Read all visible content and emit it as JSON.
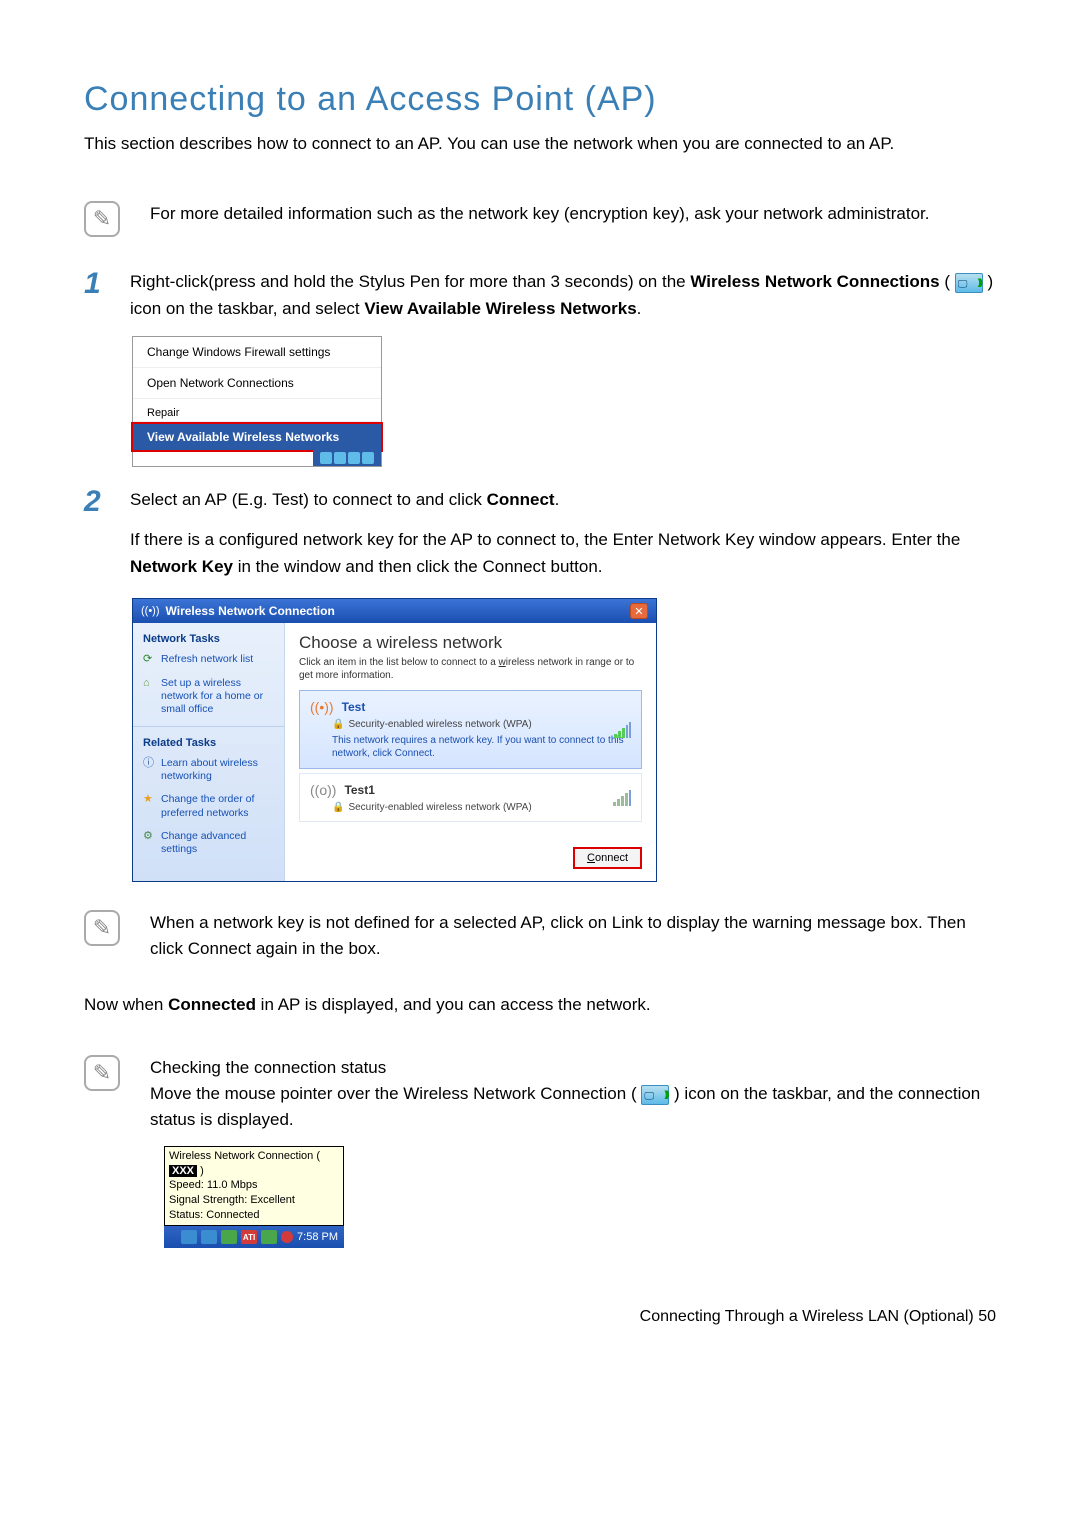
{
  "title": "Connecting to an Access Point (AP)",
  "intro": "This section describes how to connect to an AP. You can use the network when you are connected to an AP.",
  "note1": "For more detailed information such as the network key (encryption key), ask your network administrator.",
  "step1": {
    "pre": "Right-click(press and hold the Stylus Pen for more than 3 seconds) on the ",
    "bold1": "Wireless Network Connections",
    "mid1": " ( ",
    "mid2": " ) icon on the taskbar, and select ",
    "bold2": "View Available Wireless Networks",
    "end": "."
  },
  "ctx": {
    "firewall": "Change Windows Firewall settings",
    "open": "Open Network Connections",
    "repair": "Repair",
    "view": "View Available Wireless Networks"
  },
  "step2": {
    "l1a": "Select an AP (E.g. Test) to connect to and click ",
    "l1b": "Connect",
    "l1c": ".",
    "l2a": "If there is a configured network key for the AP to connect to, the Enter Network Key window appears. Enter the ",
    "l2b": "Network Key",
    "l2c": " in the window and then click the Connect button."
  },
  "wnc": {
    "title": "Wireless Network Connection",
    "side": {
      "tasks": "Network Tasks",
      "refresh": "Refresh network list",
      "setup": "Set up a wireless network for a home or small office",
      "related": "Related Tasks",
      "learn": "Learn about wireless networking",
      "order": "Change the order of preferred networks",
      "adv": "Change advanced settings"
    },
    "heading": "Choose a wireless network",
    "sub_pre": "Click an item in the list below to connect to a ",
    "sub_u": "w",
    "sub_post": "ireless network in range or to get more information.",
    "net1": {
      "name": "Test",
      "sec": "Security-enabled wireless network (WPA)",
      "desc": "This network requires a network key. If you want to connect to this network, click Connect."
    },
    "net2": {
      "name": "Test1",
      "sec": "Security-enabled wireless network (WPA)"
    },
    "connect_u": "C",
    "connect_rest": "onnect"
  },
  "note2": "When a network key is not defined for a selected AP, click on Link to display the warning message box. Then click Connect again in the box.",
  "now_pre": "Now when ",
  "now_bold": "Connected",
  "now_post": " in AP is displayed, and you can access the network.",
  "check": {
    "title": "Checking the connection status",
    "pre": "Move the mouse pointer over the Wireless Network Connection ( ",
    "post": " ) icon on the taskbar, and the connection status is displayed."
  },
  "tooltip": {
    "l1a": "Wireless Network Connection ( ",
    "l1b": "XXX",
    "l1c": " )",
    "l2": "Speed: 11.0 Mbps",
    "l3": "Signal Strength: Excellent",
    "l4": "Status: Connected"
  },
  "taskbar_time": "7:58 PM",
  "footer": "Connecting Through a Wireless LAN (Optional)    50"
}
